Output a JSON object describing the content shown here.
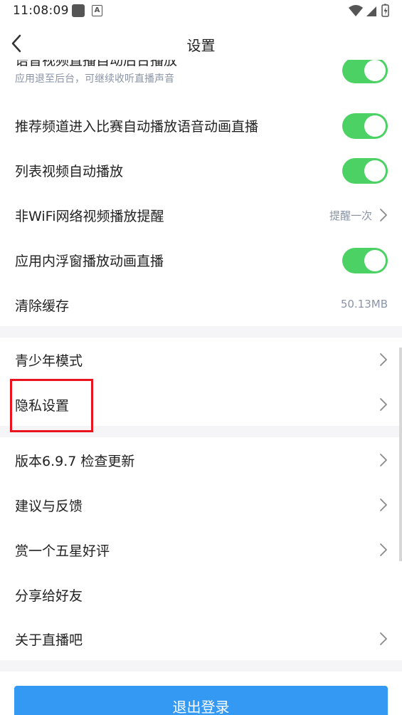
{
  "status_bar": {
    "time": "11:08:09",
    "icons": [
      "notification-square-icon",
      "a-badge-icon",
      "wifi-icon",
      "signal-icon",
      "battery-icon"
    ]
  },
  "header": {
    "title": "设置",
    "back_icon": "chevron-left-icon"
  },
  "settings": {
    "voice_background": {
      "title": "语音视频直播自动后台播放",
      "subtitle": "应用退至后台，可继续收听直播声音",
      "enabled": true
    },
    "recommend_autoplay": {
      "label": "推荐频道进入比赛自动播放语音动画直播",
      "enabled": true
    },
    "list_video_autoplay": {
      "label": "列表视频自动播放",
      "enabled": true
    },
    "non_wifi_reminder": {
      "label": "非WiFi网络视频播放提醒",
      "value": "提醒一次"
    },
    "floating_window": {
      "label": "应用内浮窗播放动画直播",
      "enabled": true
    },
    "clear_cache": {
      "label": "清除缓存",
      "value": "50.13MB"
    }
  },
  "section2": {
    "teen_mode": {
      "label": "青少年模式"
    },
    "privacy": {
      "label": "隐私设置"
    }
  },
  "section3": {
    "version": {
      "label": "版本6.9.7  检查更新"
    },
    "feedback": {
      "label": "建议与反馈"
    },
    "rate": {
      "label": "赏一个五星好评"
    },
    "share": {
      "label": "分享给好友"
    },
    "about": {
      "label": "关于直播吧"
    }
  },
  "logout": {
    "label": "退出登录"
  },
  "colors": {
    "toggle_on": "#4cd264",
    "accent_blue": "#3399f3",
    "highlight_red": "#e8141e",
    "secondary_text": "#8a94a6",
    "separator": "#f5f5f7"
  }
}
